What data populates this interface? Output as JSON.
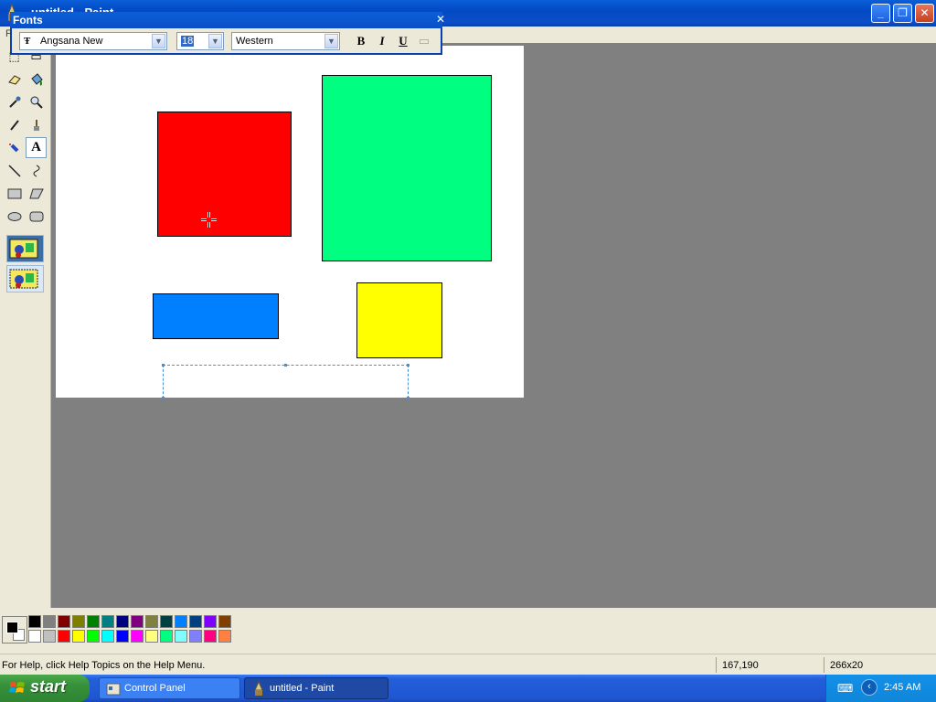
{
  "window": {
    "title": "untitled - Paint",
    "title_visible": "untitled - Paint",
    "menu_hint": "F"
  },
  "fonts_toolbar": {
    "title": "Fonts",
    "font_name": "Angsana New",
    "font_size": "18",
    "script": "Western",
    "bold_label": "B",
    "italic_label": "I",
    "underline_label": "U"
  },
  "colors": {
    "red": "#ff0000",
    "green": "#00ff80",
    "blue": "#0080ff",
    "yellow": "#ffff00",
    "foreground": "#000000",
    "background": "#ffffff"
  },
  "palette_top": [
    "#000000",
    "#808080",
    "#800000",
    "#808000",
    "#008000",
    "#008080",
    "#000080",
    "#800080",
    "#808040",
    "#004040",
    "#0080ff",
    "#004080",
    "#8000ff",
    "#804000"
  ],
  "palette_bottom": [
    "#ffffff",
    "#c0c0c0",
    "#ff0000",
    "#ffff00",
    "#00ff00",
    "#00ffff",
    "#0000ff",
    "#ff00ff",
    "#ffff80",
    "#00ff80",
    "#80ffff",
    "#8080ff",
    "#ff0080",
    "#ff8040"
  ],
  "status": {
    "help_text": "For Help, click Help Topics on the Help Menu.",
    "coords": "167,190",
    "size": "266x20"
  },
  "taskbar": {
    "start_label": "start",
    "tasks": [
      {
        "label": "Control Panel"
      },
      {
        "label": "untitled - Paint"
      }
    ],
    "clock": "2:45 AM"
  }
}
